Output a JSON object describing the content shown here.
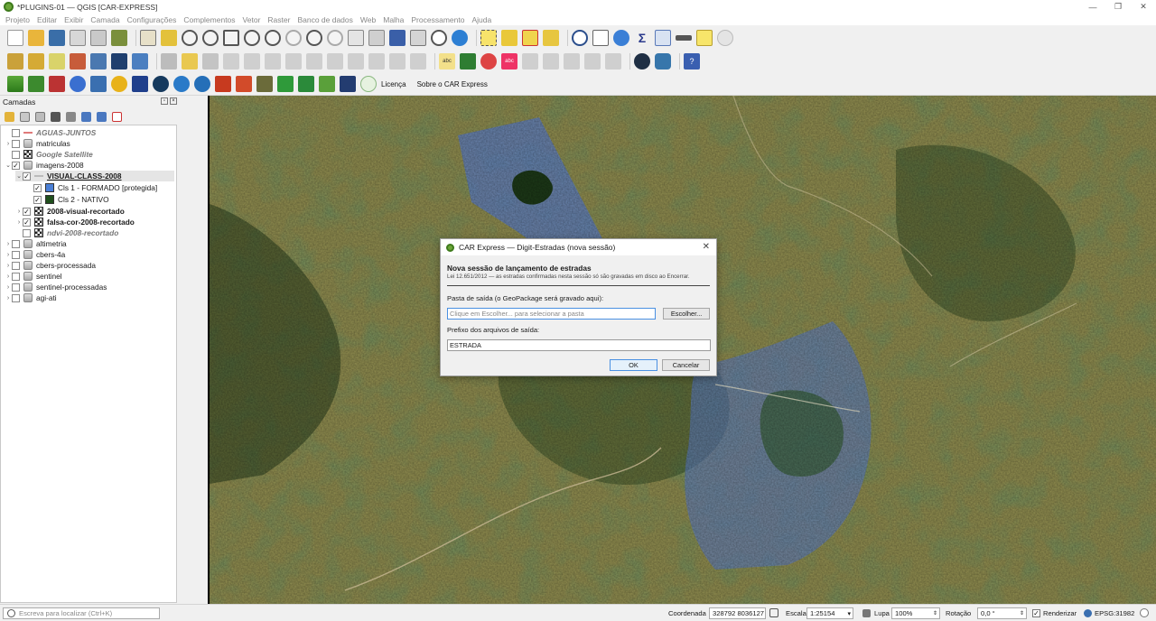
{
  "window": {
    "title": "*PLUGINS-01 — QGIS [CAR-EXPRESS]",
    "controls": [
      "—",
      "❐",
      "✕"
    ]
  },
  "menu": [
    "Projeto",
    "Editar",
    "Exibir",
    "Camada",
    "Configurações",
    "Complementos",
    "Vetor",
    "Raster",
    "Banco de dados",
    "Web",
    "Malha",
    "Processamento",
    "Ajuda"
  ],
  "plugin_toolbar": {
    "links": [
      "Licença",
      "Sobre o CAR Express"
    ]
  },
  "layers_panel": {
    "title": "Camadas",
    "items": [
      {
        "label": "AGUAS-JUNTOS",
        "checked": false,
        "style": "vector-italic"
      },
      {
        "label": "matriculas",
        "checked": false,
        "style": "group"
      },
      {
        "label": "Google Satellite",
        "checked": false,
        "style": "raster-italic"
      },
      {
        "label": "imagens-2008",
        "checked": true,
        "style": "group"
      },
      {
        "label": "VISUAL-CLASS-2008",
        "checked": true,
        "style": "vector-bold"
      },
      {
        "label": "Cls 1 - FORMADO [protegida]",
        "checked": true,
        "style": "class"
      },
      {
        "label": "Cls 2 - NATIVO",
        "checked": true,
        "style": "class"
      },
      {
        "label": "2008-visual-recortado",
        "checked": true,
        "style": "raster-bold"
      },
      {
        "label": "falsa-cor-2008-recortado",
        "checked": true,
        "style": "raster-bold"
      },
      {
        "label": "ndvi-2008-recortado",
        "checked": false,
        "style": "raster-italic"
      },
      {
        "label": "altimetria",
        "checked": false,
        "style": "group"
      },
      {
        "label": "cbers-4a",
        "checked": false,
        "style": "group"
      },
      {
        "label": "cbers-processada",
        "checked": false,
        "style": "group"
      },
      {
        "label": "sentinel",
        "checked": false,
        "style": "group"
      },
      {
        "label": "sentinel-processadas",
        "checked": false,
        "style": "group"
      },
      {
        "label": "agi-ati",
        "checked": false,
        "style": "group"
      }
    ]
  },
  "dialog": {
    "title": "CAR Express — Digit-Estradas (nova sessão)",
    "heading": "Nova sessão de lançamento de estradas",
    "note": "Lei 12.651/2012 — as estradas confirmadas nesta sessão só são gravadas em disco ao Encerrar.",
    "folder_label": "Pasta de saída (o GeoPackage será gravado aqui):",
    "folder_placeholder": "Clique em Escolher... para selecionar a pasta",
    "choose_button": "Escolher...",
    "prefix_label": "Prefixo dos arquivos de saída:",
    "prefix_value": "ESTRADA",
    "ok_button": "OK",
    "cancel_button": "Cancelar"
  },
  "statusbar": {
    "locator_placeholder": "Escreva para localizar (Ctrl+K)",
    "coord_label": "Coordenada",
    "coord_value": "328792  8036127",
    "scale_label": "Escala",
    "scale_value": "1:25154",
    "magnifier_label": "Lupa",
    "magnifier_value": "100%",
    "rotation_label": "Rotação",
    "rotation_value": "0,0 °",
    "render_label": "Renderizar",
    "crs": "EPSG:31982"
  }
}
